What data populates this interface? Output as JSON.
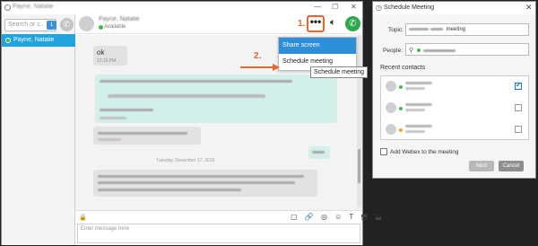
{
  "chat_window": {
    "title": "Payne, Natalie",
    "window_controls": [
      "—",
      "☐",
      "✕"
    ],
    "sidebar": {
      "search_placeholder": "Search or c...",
      "search_count": "1",
      "contact_selected": "Payne, Natalie"
    },
    "header": {
      "contact_name": "Payne, Natalie",
      "status": "Available",
      "step1_label": "1.",
      "more_label": "•••"
    },
    "messages": {
      "ok_text": "ok",
      "ok_time": "12:15 PM",
      "date_separator": "Tuesday, December 17, 2019"
    },
    "menu": {
      "share_screen": "Share screen",
      "schedule_meeting": "Schedule meeting"
    },
    "tooltip": "Schedule meeting",
    "step2_label": "2.",
    "compose": {
      "placeholder": "Enter message here",
      "lock_icon": "🔒",
      "toolbar_icons": "▢ 🔗 ◎ ☺ T ⬒ ⬓"
    }
  },
  "dialog": {
    "title": "Schedule Meeting",
    "close": "✕",
    "topic_label": "Topic:",
    "topic_value": "meeting",
    "people_label": "People:",
    "recent_label": "Recent contacts",
    "recent_contacts": [
      {
        "status_color": "#3cbf3c",
        "checked": true
      },
      {
        "status_color": "#3cbf3c",
        "checked": false
      },
      {
        "status_color": "#f0a030",
        "checked": false
      }
    ],
    "webex_label": "Add Webex to the meeting",
    "next_label": "Next",
    "cancel_label": "Cancel"
  },
  "colors": {
    "accent_orange": "#e8652e",
    "menu_blue": "#2d8fd8",
    "selection_blue": "#20a3df",
    "call_green": "#2ea84d"
  }
}
